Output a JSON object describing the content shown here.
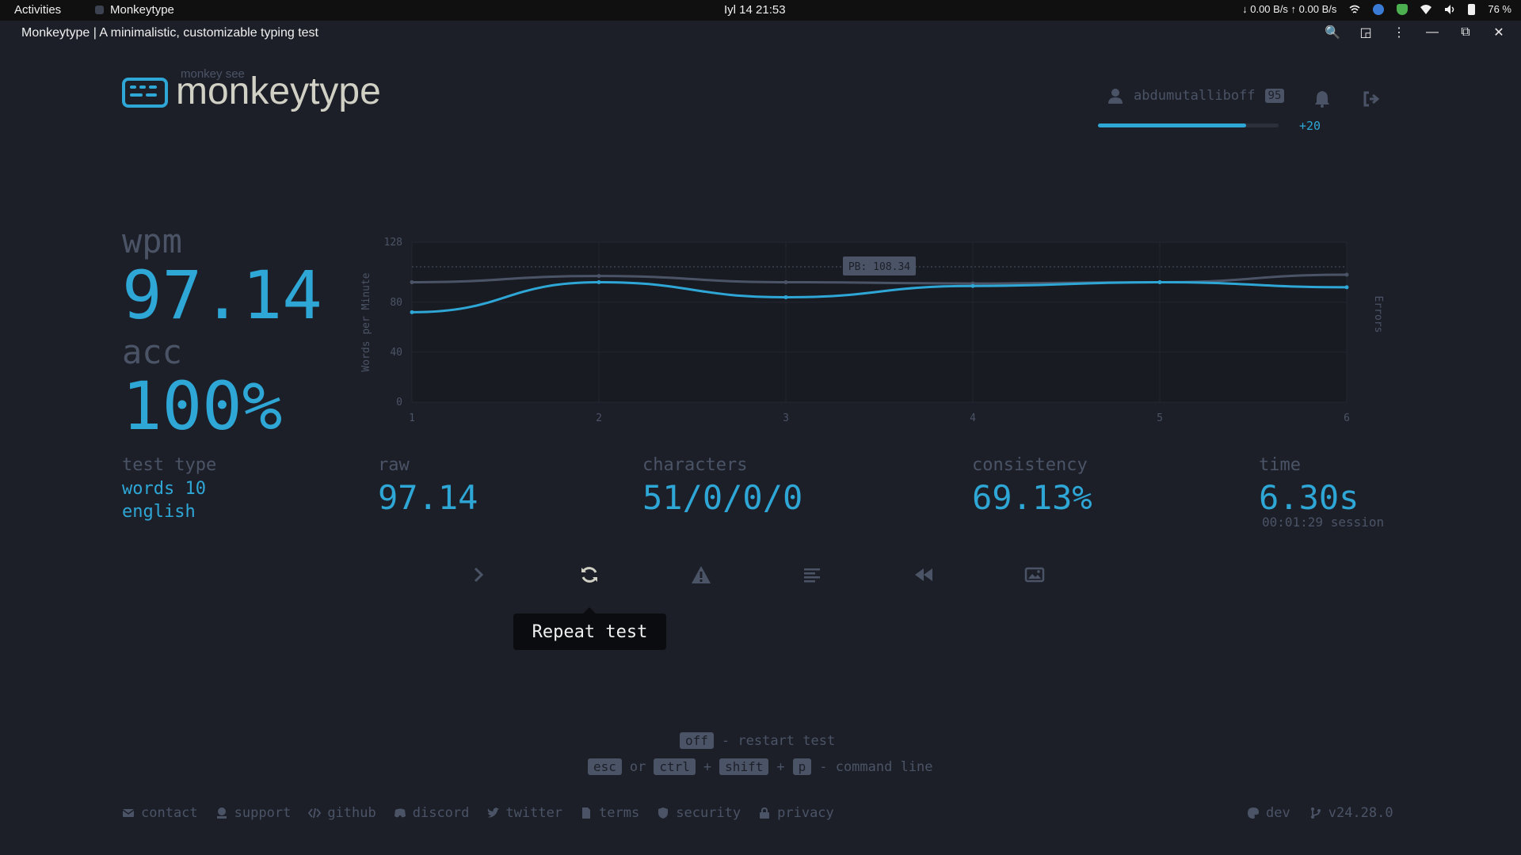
{
  "system": {
    "activities": "Activities",
    "app_name": "Monkeytype",
    "clock": "Iyl 14  21:53",
    "net_speed": "↓ 0.00 B/s ↑ 0.00 B/s",
    "battery": "76 %"
  },
  "browser": {
    "title": "Monkeytype | A minimalistic, customizable typing test"
  },
  "header": {
    "logo_sub": "monkey see",
    "logo_text": "monkeytype",
    "username": "abdumutalliboff",
    "level": "95",
    "xp_fraction": 0.82,
    "xp_gain": "+20"
  },
  "result": {
    "wpm_label": "wpm",
    "wpm_value": "97.14",
    "acc_label": "acc",
    "acc_value": "100%",
    "test_type_label": "test type",
    "test_type_lines": [
      "words 10",
      "english"
    ],
    "raw_label": "raw",
    "raw_value": "97.14",
    "characters_label": "characters",
    "characters_value": "51/0/0/0",
    "consistency_label": "consistency",
    "consistency_value": "69.13%",
    "time_label": "time",
    "time_value": "6.30s",
    "session": "00:01:29 session"
  },
  "chart_data": {
    "type": "line",
    "x": [
      1,
      2,
      3,
      4,
      5,
      6
    ],
    "ylabel": "Words per Minute",
    "y2label": "Errors",
    "ylim": [
      0,
      128
    ],
    "yticks": [
      0,
      40,
      80,
      128
    ],
    "pb_label": "PB: 108.34",
    "pb_value": 108.34,
    "series": [
      {
        "name": "wpm",
        "color": "#2ea7d6",
        "values": [
          72,
          96,
          84,
          93,
          96,
          92
        ]
      },
      {
        "name": "raw",
        "color": "#4b5466",
        "values": [
          96,
          101,
          96,
          95,
          96,
          102
        ]
      }
    ],
    "grid": true
  },
  "actions": {
    "tooltip": "Repeat test",
    "buttons": [
      "next-test",
      "repeat-test",
      "practice-words",
      "words-history",
      "replay",
      "save-screenshot"
    ]
  },
  "hints": {
    "restart_key": "off",
    "restart_text": "- restart test",
    "esc_key": "esc",
    "or_text": "or",
    "ctrl_key": "ctrl",
    "plus": "+",
    "shift_key": "shift",
    "p_key": "p",
    "command_text": "- command line"
  },
  "footer": {
    "links": [
      "contact",
      "support",
      "github",
      "discord",
      "twitter",
      "terms",
      "security",
      "privacy"
    ],
    "theme": "dev",
    "version": "v24.28.0"
  },
  "colors": {
    "background": "#1c1f28",
    "accent": "#2ea7d6",
    "sub": "#4b5466",
    "text": "#d1d0c5"
  }
}
